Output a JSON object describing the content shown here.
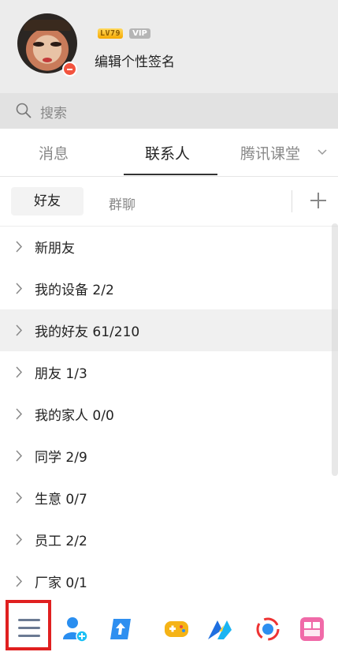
{
  "profile": {
    "level_badge": "LV79",
    "vip_badge": "VIP",
    "signature": "编辑个性签名"
  },
  "search": {
    "placeholder": "搜索"
  },
  "tabs": [
    {
      "label": "消息",
      "active": false
    },
    {
      "label": "联系人",
      "active": true
    },
    {
      "label": "腾讯课堂",
      "active": false
    }
  ],
  "subtabs": {
    "friends": "好友",
    "groups": "群聊"
  },
  "contact_groups": [
    {
      "label": "新朋友",
      "selected": false
    },
    {
      "label": "我的设备 2/2",
      "selected": false
    },
    {
      "label": "我的好友 61/210",
      "selected": true
    },
    {
      "label": "朋友 1/3",
      "selected": false
    },
    {
      "label": "我的家人 0/0",
      "selected": false
    },
    {
      "label": "同学 2/9",
      "selected": false
    },
    {
      "label": "生意 0/7",
      "selected": false
    },
    {
      "label": "员工 2/2",
      "selected": false
    },
    {
      "label": "厂家 0/1",
      "selected": false
    }
  ],
  "bottom_bar": {
    "icons": [
      "menu-icon",
      "add-contact-icon",
      "upload-icon",
      "game-icon",
      "tencent-class-icon",
      "baidu-icon",
      "pink-app-icon"
    ],
    "highlight_color": "#e02020"
  }
}
